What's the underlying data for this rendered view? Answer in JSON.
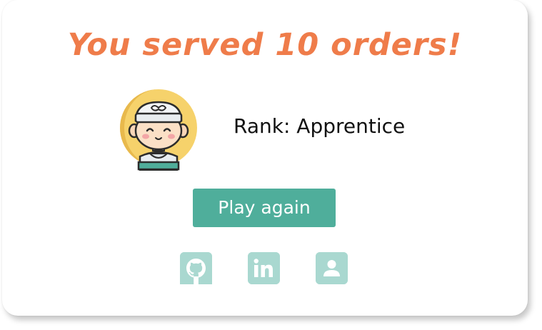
{
  "result": {
    "title": "You served 10 orders!",
    "rank_text": "Rank: Apprentice",
    "avatar_icon": "chef-avatar-icon"
  },
  "actions": {
    "play_again_label": "Play again"
  },
  "social_links": [
    {
      "icon": "github-icon"
    },
    {
      "icon": "linkedin-icon"
    },
    {
      "icon": "profile-icon"
    }
  ],
  "colors": {
    "title": "#ef7c4a",
    "button": "#4fae9b",
    "social_icon": "#a9d8d0",
    "avatar_circle": "#f6d26b"
  }
}
